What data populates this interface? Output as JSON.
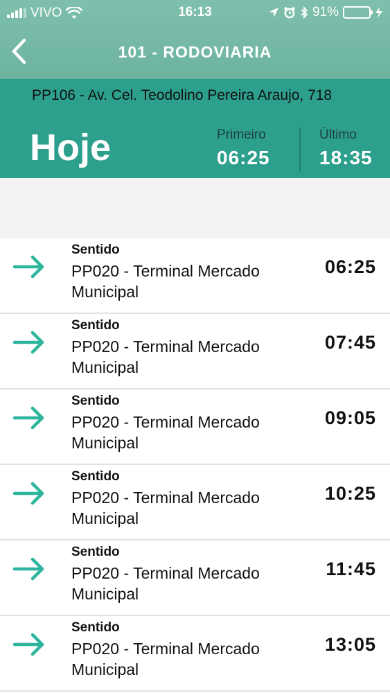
{
  "status_bar": {
    "carrier": "VIVO",
    "time": "16:13",
    "battery": "91%",
    "battery_level": 0.91
  },
  "header": {
    "title": "101 - RODOVIARIA"
  },
  "route": {
    "stop": "PP106 - Av. Cel. Teodolino Pereira Araujo, 718",
    "day": "Hoje",
    "first_label": "Primeiro",
    "first_value": "06:25",
    "last_label": "Último",
    "last_value": "18:35"
  },
  "departures": [
    {
      "label": "Sentido",
      "destination": "PP020 - Terminal Mercado Municipal",
      "time": "06:25"
    },
    {
      "label": "Sentido",
      "destination": "PP020 - Terminal Mercado Municipal",
      "time": "07:45"
    },
    {
      "label": "Sentido",
      "destination": "PP020 - Terminal Mercado Municipal",
      "time": "09:05"
    },
    {
      "label": "Sentido",
      "destination": "PP020 - Terminal Mercado Municipal",
      "time": "10:25"
    },
    {
      "label": "Sentido",
      "destination": "PP020 - Terminal Mercado Municipal",
      "time": "11:45"
    },
    {
      "label": "Sentido",
      "destination": "PP020 - Terminal Mercado Municipal",
      "time": "13:05"
    }
  ],
  "colors": {
    "header": "#6cb39f",
    "route_panel": "#2d9f8d",
    "arrow": "#2db59e",
    "battery": "#4cd964"
  },
  "icons": {
    "back": "chevron-left-icon",
    "direction": "arrow-right-icon",
    "wifi": "wifi-icon",
    "location": "location-arrow-icon",
    "alarm": "alarm-icon",
    "bluetooth": "bluetooth-icon",
    "charging": "lightning-icon"
  }
}
